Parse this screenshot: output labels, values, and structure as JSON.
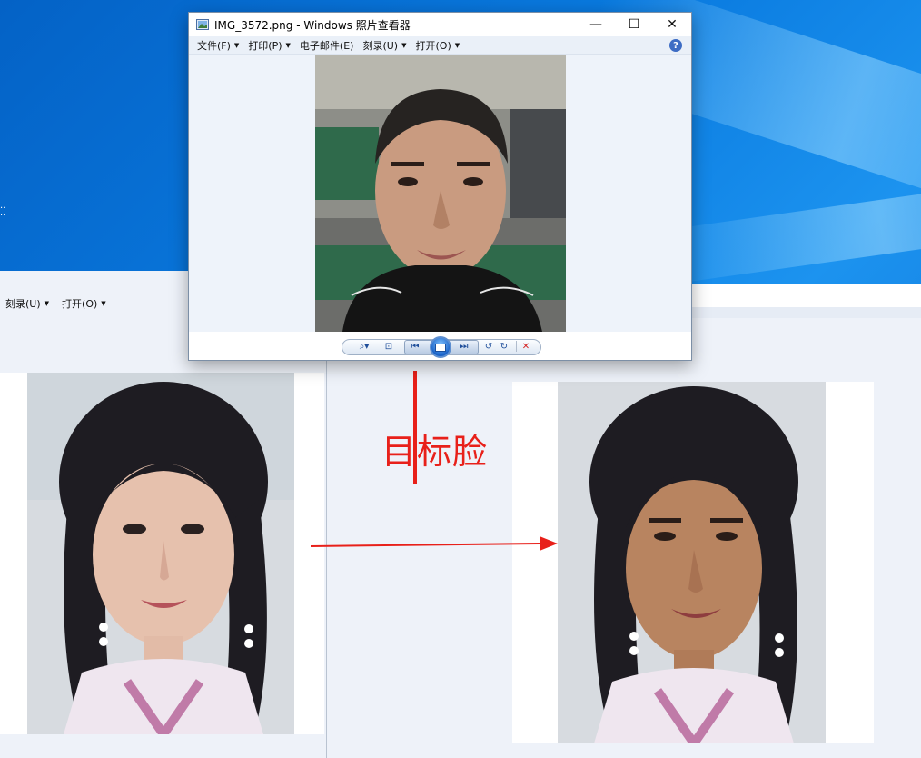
{
  "window": {
    "title": "IMG_3572.png - Windows 照片查看器",
    "controls": [
      "minimize-icon",
      "maximize-icon",
      "close-icon"
    ],
    "menu": [
      {
        "label": "文件(F)"
      },
      {
        "label": "打印(P)"
      },
      {
        "label": "电子邮件(E)"
      },
      {
        "label": "刻录(U)"
      },
      {
        "label": "打开(O)"
      }
    ],
    "help_label": "?",
    "control_icons": [
      "zoom-icon",
      "fit-window-icon",
      "previous-icon",
      "slideshow-icon",
      "next-icon",
      "rotate-counterclockwise-icon",
      "rotate-clockwise-icon",
      "delete-icon"
    ]
  },
  "background_window": {
    "menu": [
      {
        "label": "刻录(U)"
      },
      {
        "label": "打开(O)"
      }
    ]
  },
  "annotation": {
    "target_label": "目标脸",
    "color": "#e8201a"
  },
  "colors": {
    "desktop": "#0a78d7",
    "viewer_bg": "#eef3fa",
    "menubar_bg": "#eaf0f8"
  }
}
